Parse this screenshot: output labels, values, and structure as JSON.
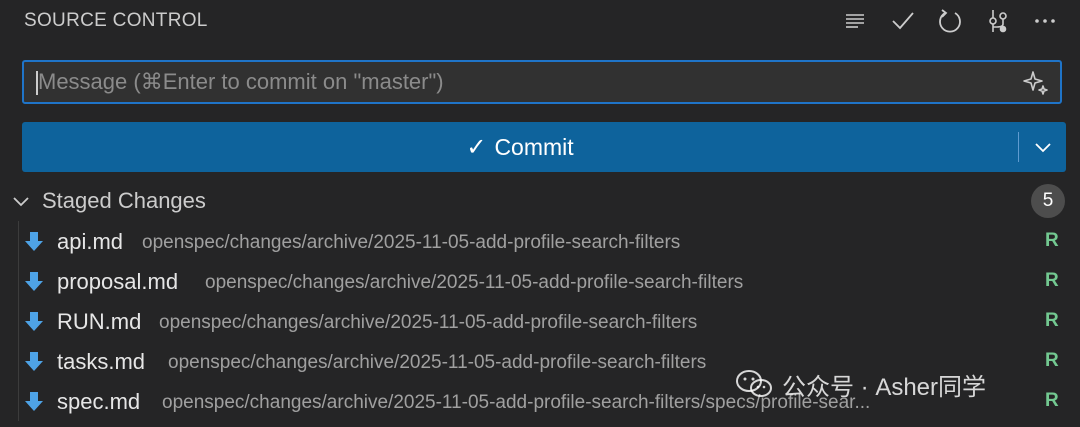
{
  "header": {
    "title": "SOURCE CONTROL",
    "icons": [
      "list-icon",
      "check-icon",
      "refresh-icon",
      "graph-icon",
      "more-icon"
    ]
  },
  "message": {
    "placeholder": "Message (⌘Enter to commit on \"master\")",
    "value": ""
  },
  "commit": {
    "check": "✓",
    "label": "Commit"
  },
  "staged": {
    "title": "Staged Changes",
    "count": "5",
    "files": [
      {
        "name": "api.md",
        "path": "openspec/changes/archive/2025-11-05-add-profile-search-filters",
        "status": "R"
      },
      {
        "name": "proposal.md",
        "path": "openspec/changes/archive/2025-11-05-add-profile-search-filters",
        "status": "R"
      },
      {
        "name": "RUN.md",
        "path": "openspec/changes/archive/2025-11-05-add-profile-search-filters",
        "status": "R"
      },
      {
        "name": "tasks.md",
        "path": "openspec/changes/archive/2025-11-05-add-profile-search-filters",
        "status": "R"
      },
      {
        "name": "spec.md",
        "path": "openspec/changes/archive/2025-11-05-add-profile-search-filters/specs/profile-sear...",
        "status": "R"
      }
    ]
  },
  "watermark": {
    "text": "公众号 · Asher同学"
  },
  "colors": {
    "background": "#252526",
    "accent": "#0e639c",
    "focus_border": "#1f74c8",
    "renamed_status": "#73c991",
    "file_icon": "#4ea3e6"
  }
}
